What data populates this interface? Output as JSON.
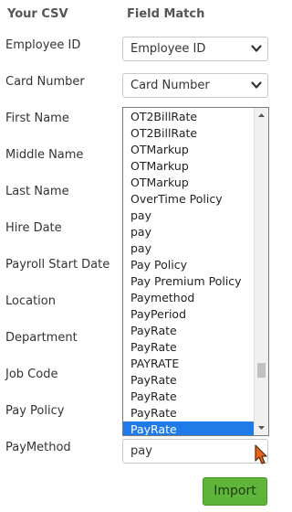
{
  "header": {
    "csv_label": "Your CSV",
    "match_label": "Field Match"
  },
  "rows": [
    {
      "label": "Employee ID"
    },
    {
      "label": "Card Number"
    },
    {
      "label": "First Name"
    },
    {
      "label": "Middle Name"
    },
    {
      "label": "Last Name"
    },
    {
      "label": "Hire Date"
    },
    {
      "label": "Payroll Start Date"
    },
    {
      "label": "Location"
    },
    {
      "label": "Department"
    },
    {
      "label": "Job Code"
    },
    {
      "label": "Pay Policy"
    },
    {
      "label": "PayMethod"
    }
  ],
  "selects": {
    "employee_id": "Employee ID",
    "card_number": "Card Number",
    "paymethod": "pay"
  },
  "dropdown_options": [
    "OT2BillRate",
    "OT2BillRate",
    "OTMarkup",
    "OTMarkup",
    "OTMarkup",
    "OverTime Policy",
    "pay",
    "pay",
    "pay",
    "Pay Policy",
    "Pay Premium Policy",
    "Paymethod",
    "PayPeriod",
    "PayRate",
    "PayRate",
    "PAYRATE",
    "PayRate",
    "PayRate",
    "PayRate",
    "PayRate"
  ],
  "dropdown_selected_index": 19,
  "import_button": "Import",
  "colors": {
    "selected_bg": "#1e7be8",
    "button_bg": "#5fb53a",
    "cursor": "#e8641e"
  },
  "icons": {
    "select_arrow": "chevron-down-icon",
    "scroll_up": "scroll-up-arrow-icon",
    "scroll_down": "scroll-down-arrow-icon",
    "cursor": "mouse-cursor-icon"
  }
}
